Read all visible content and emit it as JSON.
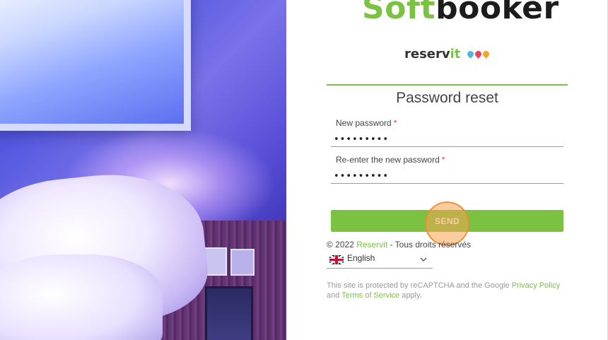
{
  "brand": {
    "softbooker_soft": "Soft",
    "softbooker_booker": "booker",
    "reservit_reserv": "reserv",
    "reservit_it": "it",
    "pin_colors": [
      "#4db6e2",
      "#e6455d",
      "#f5a623"
    ]
  },
  "form": {
    "title": "Password reset",
    "new_password": {
      "label": "New password",
      "required_mark": "*",
      "value": "•••••••••"
    },
    "confirm_password": {
      "label": "Re-enter the new password",
      "required_mark": "*",
      "value": "•••••••••"
    },
    "send_label": "SEND"
  },
  "footer": {
    "copyright_prefix": "© 2022 ",
    "company_link": "Reservit",
    "copyright_suffix": " - Tous droits réservés",
    "language": {
      "selected": "English",
      "flag_icon": "uk-flag-icon"
    },
    "recaptcha_prefix": "This site is protected by reCAPTCHA and the Google ",
    "privacy_link": "Privacy Policy",
    "and_text": " and ",
    "terms_link": "Terms of Service",
    "apply_text": " apply."
  },
  "colors": {
    "accent_green": "#7cc242",
    "required_red": "#e53935",
    "highlight_orange": "#f6a450"
  }
}
